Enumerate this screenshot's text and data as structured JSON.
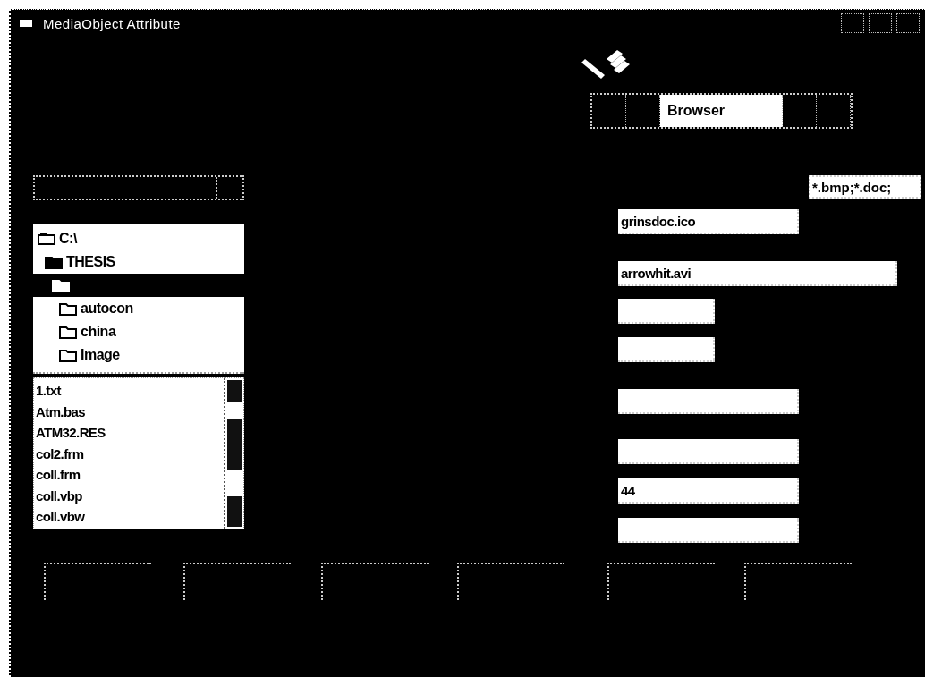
{
  "window": {
    "title": "MediaObject Attribute"
  },
  "toolbar": {
    "tabs": [
      {
        "selected": false
      },
      {
        "selected": false
      },
      {
        "label": "Browser",
        "selected": true
      },
      {
        "selected": false
      },
      {
        "selected": false
      }
    ]
  },
  "folder_tree": {
    "items": [
      {
        "label": "C:\\",
        "kind": "drive",
        "selected": false,
        "children": [
          {
            "label": "THESIS",
            "kind": "open",
            "selected": false,
            "children": [
              {
                "kind": "open",
                "selected": true,
                "children": [
                  {
                    "label": "autocon",
                    "kind": "folder",
                    "selected": false
                  },
                  {
                    "label": "china",
                    "kind": "folder",
                    "selected": false
                  },
                  {
                    "label": "Image",
                    "kind": "folder",
                    "selected": false
                  }
                ]
              }
            ]
          }
        ]
      }
    ]
  },
  "file_list": {
    "items": [
      "1.txt",
      "Atm.bas",
      "ATM32.RES",
      "col2.frm",
      "coll.frm",
      "coll.vbp",
      "coll.vbw"
    ]
  },
  "filter_field": {
    "value": "*.bmp;*.doc;"
  },
  "fields": [
    {
      "kind": "medium",
      "value": "grinsdoc.ico"
    },
    {
      "kind": "long",
      "value": "arrowhit.avi"
    },
    {
      "kind": "short"
    },
    {
      "kind": "short"
    },
    {
      "kind": "medium"
    },
    {
      "kind": "medium"
    },
    {
      "kind": "medium",
      "value": "44"
    },
    {
      "kind": "medium"
    }
  ],
  "buttons": [
    {
      "kind": "push"
    },
    {
      "kind": "push"
    },
    {
      "kind": "push"
    },
    {
      "kind": "push"
    },
    {
      "kind": "push"
    },
    {
      "kind": "push"
    }
  ]
}
